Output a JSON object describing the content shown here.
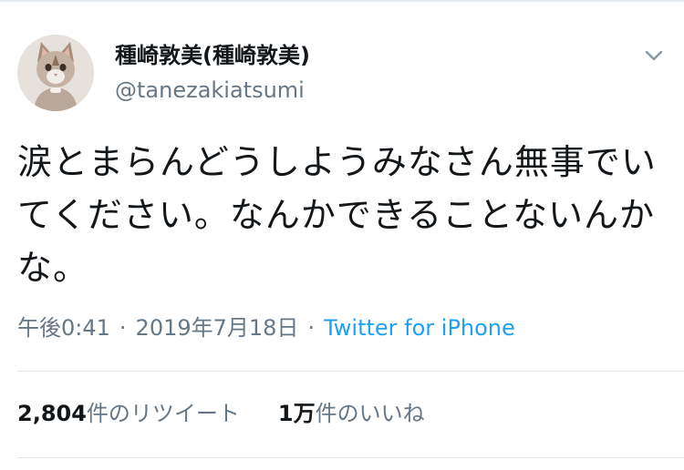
{
  "user": {
    "display_name": "種崎敦美(種崎敦美)",
    "handle": "@tanezakiatsumi"
  },
  "tweet": {
    "text": "涙とまらんどうしようみなさん無事でいてください。なんかできることないんかな。",
    "time": "午後0:41",
    "date": "2019年7月18日",
    "separator": "·",
    "source": "Twitter for iPhone"
  },
  "stats": {
    "retweets_count": "2,804",
    "retweets_label": "件のリツイート",
    "likes_count": "1万",
    "likes_label": "件のいいね"
  },
  "icons": {
    "menu": "chevron-down-icon",
    "avatar": "cat-avatar"
  },
  "colors": {
    "link": "#1da1f2",
    "secondary_text": "#657786",
    "divider": "#e1e8ed"
  }
}
